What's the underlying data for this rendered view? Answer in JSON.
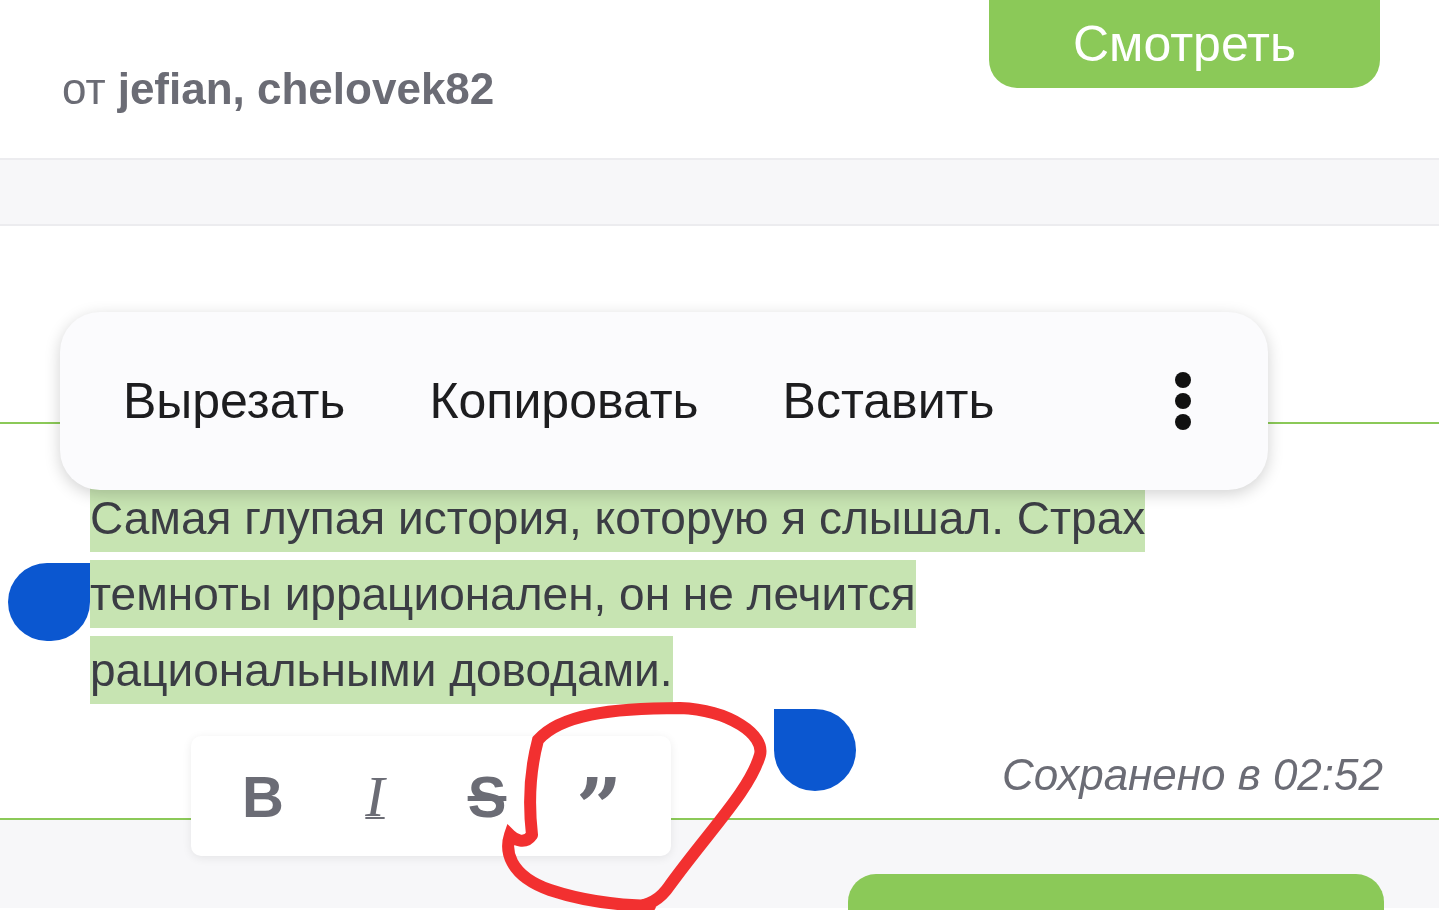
{
  "header": {
    "by_prefix": "от",
    "authors": "jefian, chelovek82",
    "view_button": "Смотреть"
  },
  "context_menu": {
    "items": [
      "Вырезать",
      "Копировать",
      "Вставить"
    ]
  },
  "editor": {
    "text": "Самая глупая история, которую я слышал. Страх темноты иррационален, он не лечится рациональными доводами.",
    "selected": true,
    "status": "Сохранено в 02:52"
  },
  "format_toolbar": [
    {
      "kind": "bold",
      "label": "B"
    },
    {
      "kind": "italic",
      "label": "I"
    },
    {
      "kind": "strike",
      "label": "S"
    },
    {
      "kind": "quote",
      "label": "”"
    }
  ]
}
